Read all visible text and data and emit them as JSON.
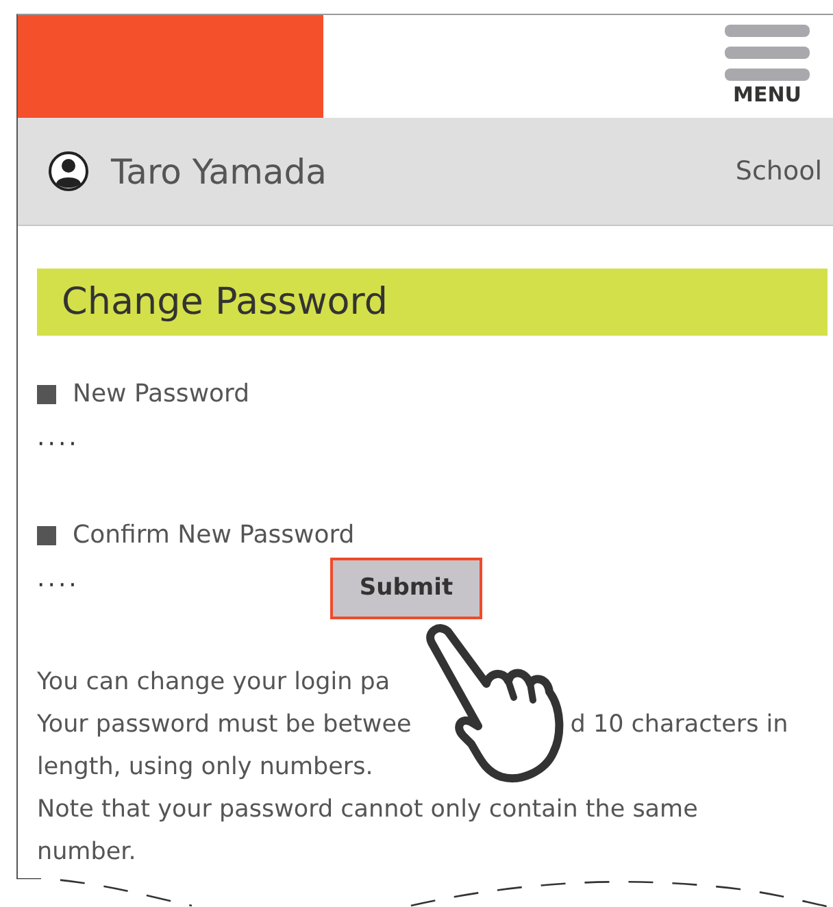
{
  "header": {
    "menu_label": "MENU"
  },
  "user_bar": {
    "name": "Taro Yamada",
    "school": "School"
  },
  "page_title": "Change Password",
  "fields": [
    {
      "label": "New Password",
      "value": "····"
    },
    {
      "label": "Confirm New Password",
      "value": "····"
    }
  ],
  "submit_button": {
    "label": "Submit",
    "highlighted": true
  },
  "notes": [
    {
      "segments": [
        "You can change your login pa"
      ]
    },
    {
      "segments": [
        "Your password must be betwee",
        "d 10 characters in"
      ]
    },
    {
      "segments": [
        "length, using only numbers."
      ]
    },
    {
      "segments": [
        "Note that your password cannot only contain the same"
      ]
    },
    {
      "segments": [
        "number."
      ]
    }
  ]
}
